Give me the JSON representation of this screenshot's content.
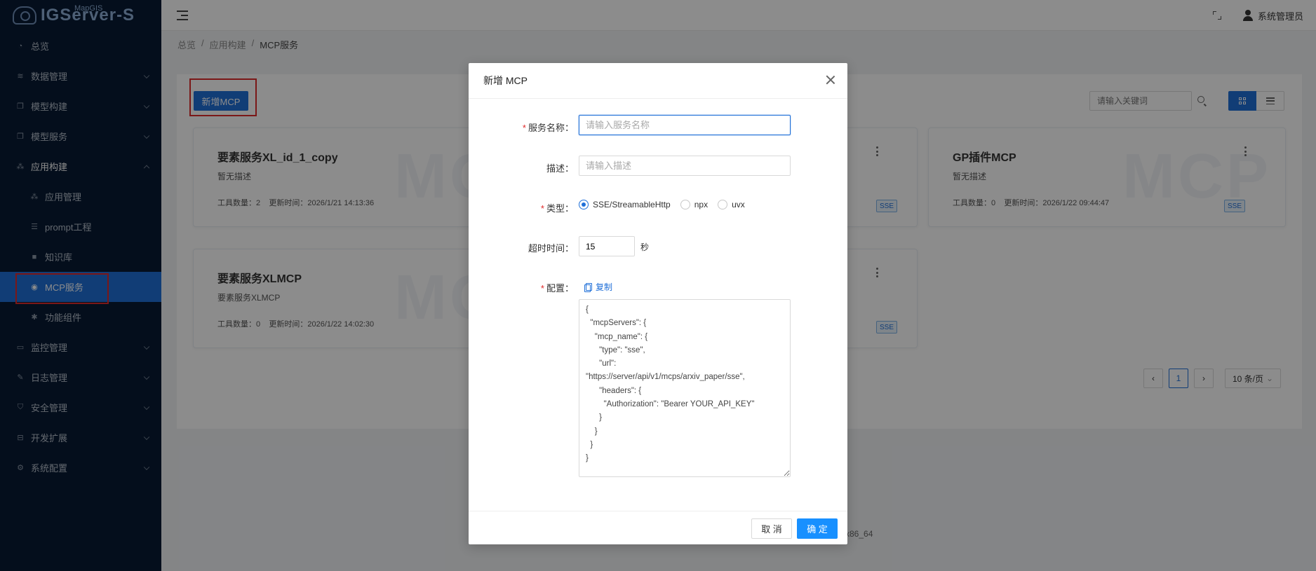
{
  "app": {
    "logo_text": "IGServer-S",
    "logo_sup": "MapGIS"
  },
  "sidebar": {
    "items": [
      {
        "label": "总览",
        "icon": "dashboard-icon"
      },
      {
        "label": "数据管理",
        "icon": "database-icon"
      },
      {
        "label": "模型构建",
        "icon": "layers-icon"
      },
      {
        "label": "模型服务",
        "icon": "layers-icon"
      },
      {
        "label": "应用构建",
        "icon": "cluster-icon"
      },
      {
        "label": "应用管理",
        "icon": "cluster-icon"
      },
      {
        "label": "prompt工程",
        "icon": "prompt-icon"
      },
      {
        "label": "知识库",
        "icon": "book-icon"
      },
      {
        "label": "MCP服务",
        "icon": "mcp-icon"
      },
      {
        "label": "功能组件",
        "icon": "puzzle-icon"
      },
      {
        "label": "监控管理",
        "icon": "monitor-icon"
      },
      {
        "label": "日志管理",
        "icon": "log-icon"
      },
      {
        "label": "安全管理",
        "icon": "shield-icon"
      },
      {
        "label": "开发扩展",
        "icon": "extension-icon"
      },
      {
        "label": "系统配置",
        "icon": "gear-icon"
      }
    ]
  },
  "header": {
    "user_name": "系统管理员"
  },
  "breadcrumb": [
    "总览",
    "应用构建",
    "MCP服务"
  ],
  "toolbar": {
    "add_label": "新增MCP",
    "search_placeholder": "请输入关键词"
  },
  "cards": [
    {
      "title": "要素服务XL_id_1_copy",
      "desc": "暂无描述",
      "tools": "工具数量：2",
      "updated": "更新时间：2026/1/21 14:13:36",
      "tag": "SSE",
      "watermark": "MCP"
    },
    {
      "title": "GP插件MCP",
      "desc": "暂无描述",
      "tools": "工具数量：0",
      "updated": "更新时间：2026/1/22 09:44:47",
      "tag": "SSE",
      "watermark": "MCP"
    },
    {
      "title": "要素服务XLMCP",
      "desc": "要素服务XLMCP",
      "tools": "工具数量：0",
      "updated": "更新时间：2026/1/22 14:02:30",
      "tag": "SSE",
      "watermark": "MCP"
    }
  ],
  "hidden_card_tags": [
    "SSE",
    "SSE"
  ],
  "pagination": {
    "current": "1",
    "page_size": "10 条/页"
  },
  "footer_text": "x86_64",
  "modal": {
    "title": "新增 MCP",
    "fields": {
      "name_label": "服务名称：",
      "name_placeholder": "请输入服务名称",
      "desc_label": "描述：",
      "desc_placeholder": "请输入描述",
      "type_label": "类型：",
      "type_options": [
        "SSE/StreamableHttp",
        "npx",
        "uvx"
      ],
      "type_selected": "SSE/StreamableHttp",
      "timeout_label": "超时时间：",
      "timeout_value": "15",
      "timeout_unit": "秒",
      "config_label": "配置：",
      "copy_label": "复制",
      "config_value": "{\n  \"mcpServers\": {\n    \"mcp_name\": {\n      \"type\": \"sse\",\n      \"url\":\n\"https://server/api/v1/mcps/arxiv_paper/sse\",\n      \"headers\": {\n        \"Authorization\": \"Bearer YOUR_API_KEY\"\n      }\n    }\n  }\n}"
    },
    "cancel_label": "取 消",
    "ok_label": "确 定"
  },
  "colors": {
    "primary": "#1f6fd8",
    "sidebar_bg": "#081a33",
    "highlight_box": "#e12a2a",
    "required": "#e12a2a"
  }
}
